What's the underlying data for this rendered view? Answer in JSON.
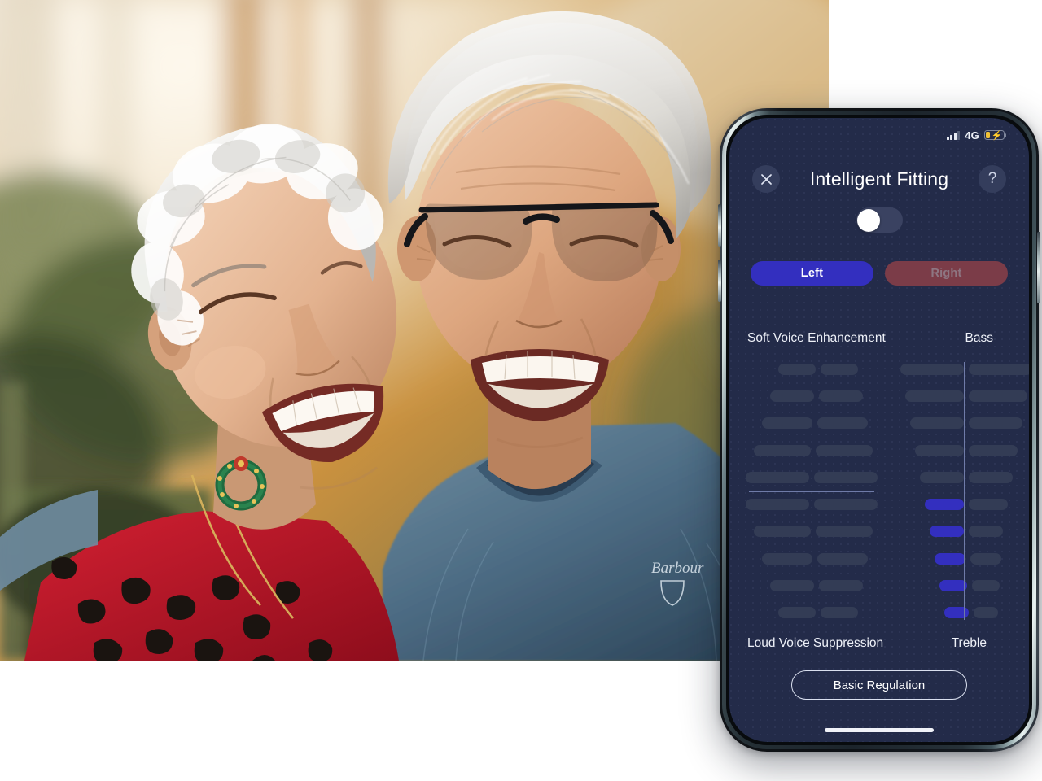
{
  "page": {
    "background_color": "#ffffff"
  },
  "photo": {
    "alt": "Smiling elderly couple outdoors in autumn, man wearing black glasses and blue sweater, woman in red leopard print top",
    "palette": {
      "sky_warm": "#e9d8bf",
      "foliage_orange": "#c98340",
      "foliage_green": "#4e5b3c",
      "hair_white": "#e8e6e2",
      "skin": "#d8a98c",
      "sweater_blue": "#4e6c85",
      "dress_red": "#c4152a",
      "glasses_black": "#15161a"
    }
  },
  "phone": {
    "frame_color": "#1c242b",
    "band_color": "#cfdcdb",
    "screen_background": "#232b49",
    "buttons": {
      "power": "side-power-button",
      "volume_up": "side-volume-up-button",
      "volume_down": "side-volume-down-button"
    }
  },
  "status_bar": {
    "signal_icon": "cellular-signal-icon",
    "signal_bars_filled": 3,
    "signal_bars_total": 4,
    "network": "4G",
    "battery_icon": "battery-charging-icon",
    "battery_level_percent": 20,
    "battery_color": "#f2c236",
    "charging": true
  },
  "header": {
    "close_icon": "close-icon",
    "close_label": "Close",
    "title": "Intelligent Fitting",
    "help_icon": "help-icon",
    "help_label": "?"
  },
  "master_toggle": {
    "name": "intelligent-fitting-toggle",
    "state": "off",
    "track_color": "#3a4261",
    "knob_color": "#ffffff"
  },
  "ear_selector": {
    "options": [
      {
        "label": "Left",
        "selected": true,
        "bg": "#332fbf",
        "fg": "#ffffff"
      },
      {
        "label": "Right",
        "selected": false,
        "bg": "#7b3c48",
        "fg": "#8e7682"
      }
    ]
  },
  "equalizer": {
    "labels": {
      "top_left": "Soft Voice Enhancement",
      "top_right": "Bass",
      "bottom_left": "Loud Voice Suppression",
      "bottom_right": "Treble"
    },
    "pill_color_off": "#333c55",
    "pill_color_on": "#332fbf",
    "divider_color": "#6f7ba8",
    "rows": 10,
    "left_column": {
      "name": "voice-enhancement-suppression-slider",
      "active_count": 0,
      "rows": [
        {
          "left_w": 46,
          "right_w": 46,
          "indent": 52,
          "on": false
        },
        {
          "left_w": 54,
          "right_w": 54,
          "indent": 42,
          "on": false
        },
        {
          "left_w": 62,
          "right_w": 62,
          "indent": 32,
          "on": false
        },
        {
          "left_w": 70,
          "right_w": 70,
          "indent": 22,
          "on": false
        },
        {
          "left_w": 78,
          "right_w": 78,
          "indent": 12,
          "on": false
        },
        {
          "left_w": 78,
          "right_w": 78,
          "indent": 12,
          "on": false
        },
        {
          "left_w": 70,
          "right_w": 70,
          "indent": 22,
          "on": false
        },
        {
          "left_w": 62,
          "right_w": 62,
          "indent": 32,
          "on": false
        },
        {
          "left_w": 54,
          "right_w": 54,
          "indent": 42,
          "on": false
        },
        {
          "left_w": 46,
          "right_w": 46,
          "indent": 52,
          "on": false
        }
      ]
    },
    "right_column": {
      "name": "bass-treble-slider",
      "active_count": 5,
      "rows": [
        {
          "left_w": 78,
          "right_w": 78,
          "indent": 0,
          "on": false
        },
        {
          "left_w": 72,
          "right_w": 72,
          "indent": 6,
          "on": false
        },
        {
          "left_w": 66,
          "right_w": 66,
          "indent": 12,
          "on": false
        },
        {
          "left_w": 60,
          "right_w": 60,
          "indent": 18,
          "on": false
        },
        {
          "left_w": 54,
          "right_w": 54,
          "indent": 24,
          "on": false
        },
        {
          "left_w": 48,
          "right_w": 48,
          "indent": 30,
          "on": true
        },
        {
          "left_w": 42,
          "right_w": 42,
          "indent": 36,
          "on": true
        },
        {
          "left_w": 38,
          "right_w": 38,
          "indent": 42,
          "on": true
        },
        {
          "left_w": 34,
          "right_w": 34,
          "indent": 48,
          "on": true
        },
        {
          "left_w": 30,
          "right_w": 30,
          "indent": 54,
          "on": true
        }
      ]
    }
  },
  "footer": {
    "basic_regulation_label": "Basic Regulation",
    "home_indicator": "home-indicator"
  }
}
